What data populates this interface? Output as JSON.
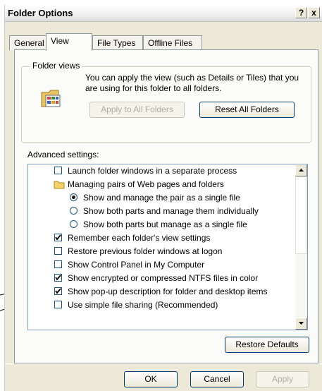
{
  "window": {
    "title": "Folder Options",
    "help_button": "?",
    "close_button": "x"
  },
  "tabs": [
    {
      "label": "General"
    },
    {
      "label": "View"
    },
    {
      "label": "File Types"
    },
    {
      "label": "Offline Files"
    }
  ],
  "folder_views": {
    "legend": "Folder views",
    "description": "You can apply the view (such as Details or Tiles) that you are using for this folder to all folders.",
    "apply_button": "Apply to All Folders",
    "reset_button": "Reset All Folders"
  },
  "advanced": {
    "label": "Advanced settings:",
    "items": [
      {
        "type": "checkbox",
        "label": "Launch folder windows in a separate process",
        "checked": false,
        "indent": 1
      },
      {
        "type": "folder",
        "label": "Managing pairs of Web pages and folders",
        "indent": 1
      },
      {
        "type": "radio",
        "label": "Show and manage the pair as a single file",
        "checked": true,
        "indent": 2
      },
      {
        "type": "radio",
        "label": "Show both parts and manage them individually",
        "checked": false,
        "indent": 2
      },
      {
        "type": "radio",
        "label": "Show both parts but manage as a single file",
        "checked": false,
        "indent": 2
      },
      {
        "type": "checkbox",
        "label": "Remember each folder's view settings",
        "checked": true,
        "indent": 0
      },
      {
        "type": "checkbox",
        "label": "Restore previous folder windows at logon",
        "checked": false,
        "indent": 0
      },
      {
        "type": "checkbox",
        "label": "Show Control Panel in My Computer",
        "checked": false,
        "indent": 0
      },
      {
        "type": "checkbox",
        "label": "Show encrypted or compressed NTFS files in color",
        "checked": true,
        "indent": 0
      },
      {
        "type": "checkbox",
        "label": "Show pop-up description for folder and desktop items",
        "checked": true,
        "indent": 0
      },
      {
        "type": "checkbox",
        "label": "Use simple file sharing (Recommended)",
        "checked": false,
        "indent": 0
      }
    ]
  },
  "restore_button": "Restore Defaults",
  "footer": {
    "ok": "OK",
    "cancel": "Cancel",
    "apply": "Apply"
  }
}
